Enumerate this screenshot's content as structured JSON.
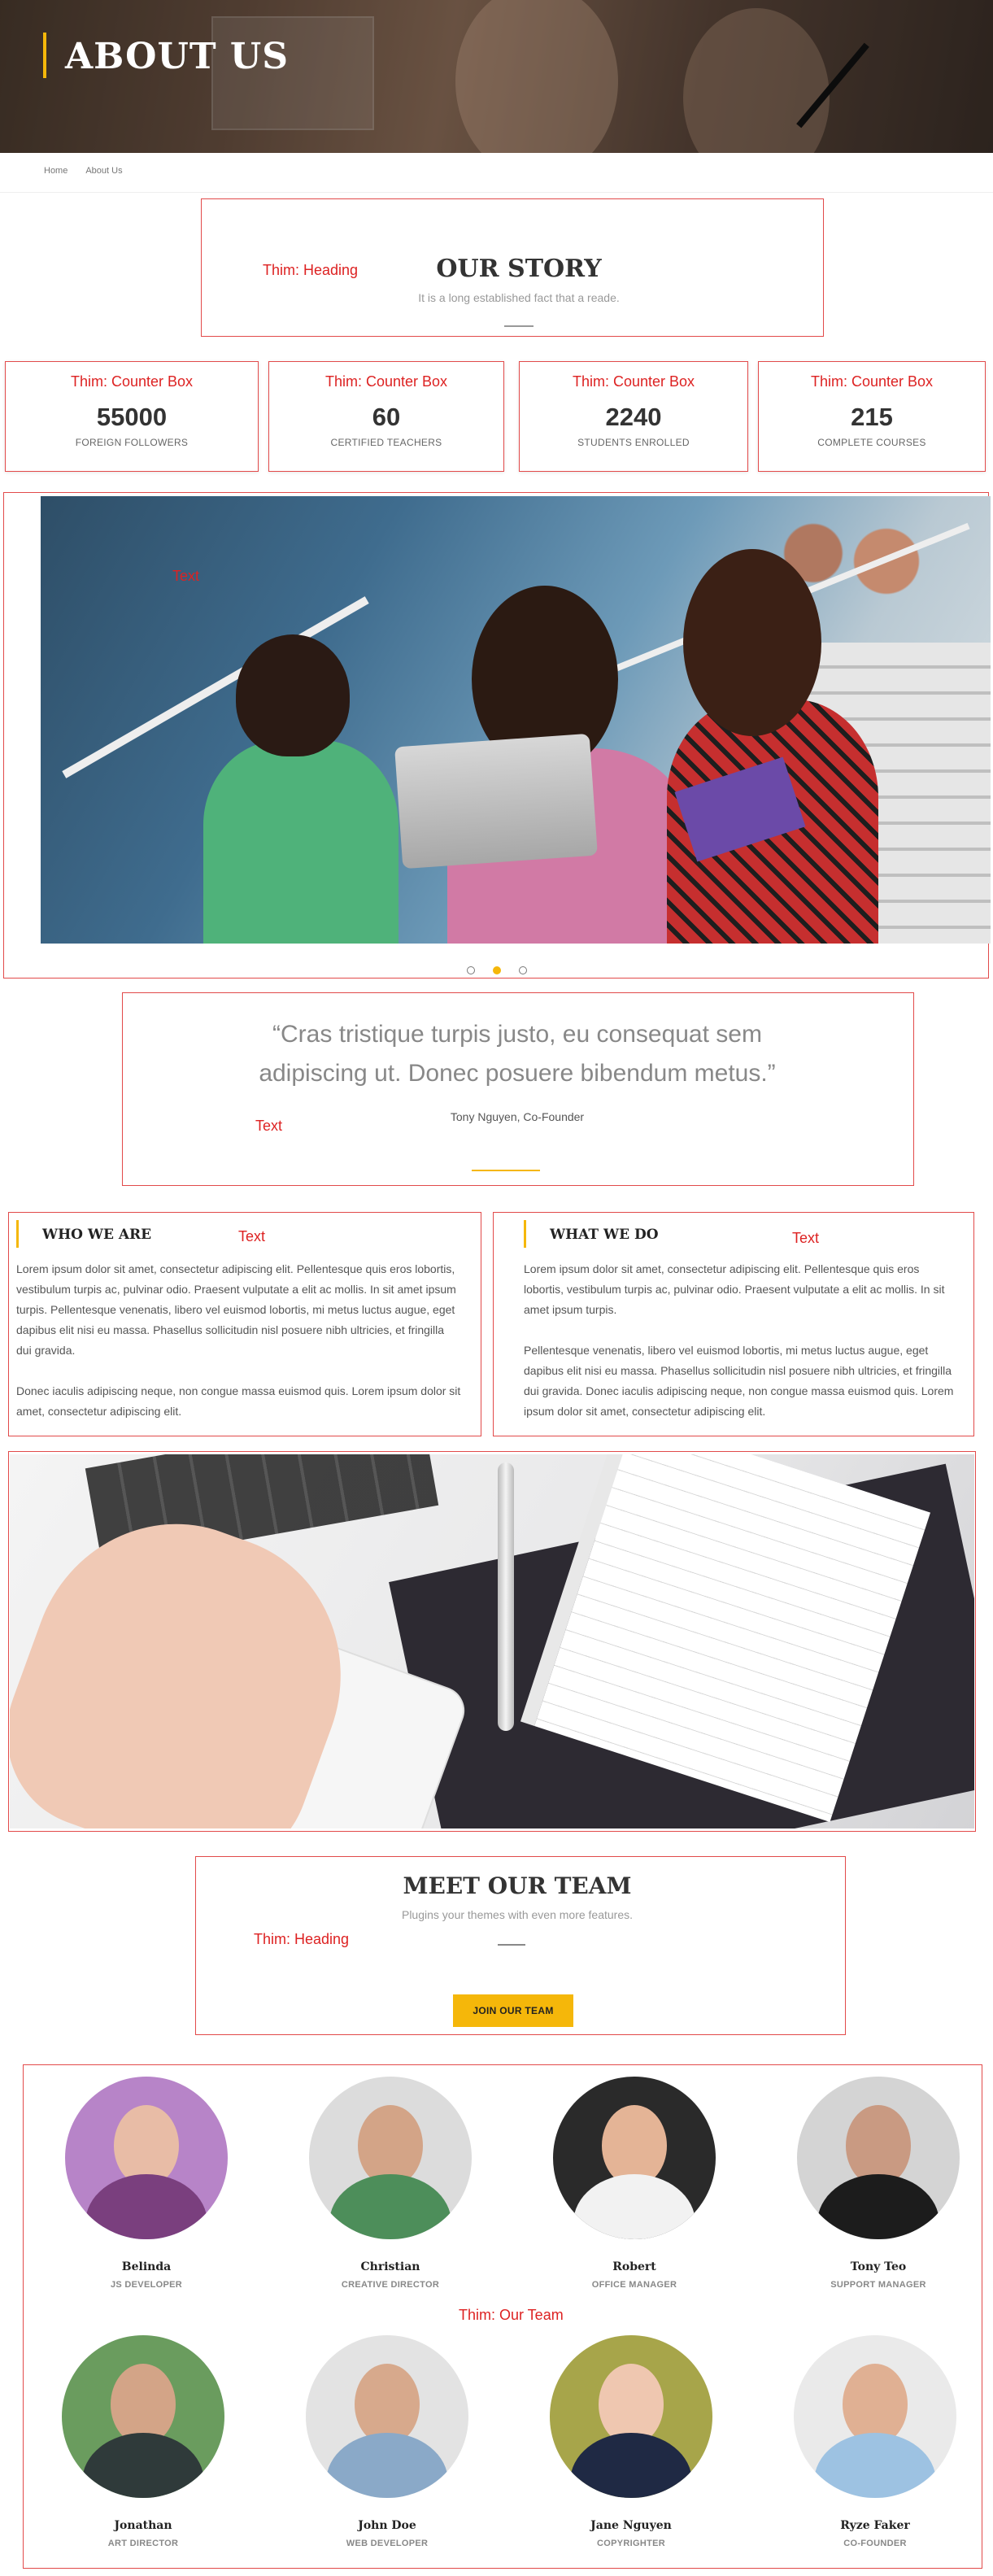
{
  "hero": {
    "title": "ABOUT US"
  },
  "breadcrumb": {
    "home": "Home",
    "current": "About Us"
  },
  "story": {
    "label": "Thim: Heading",
    "title": "OUR STORY",
    "subtitle": "It is a long established fact that a reade."
  },
  "counters": {
    "label": "Thim: Counter Box",
    "items": [
      {
        "value": "55000",
        "caption": "FOREIGN FOLLOWERS"
      },
      {
        "value": "60",
        "caption": "CERTIFIED TEACHERS"
      },
      {
        "value": "2240",
        "caption": "STUDENTS ENROLLED"
      },
      {
        "value": "215",
        "caption": "COMPLETE COURSES"
      }
    ]
  },
  "slider": {
    "label": "Text",
    "active_dot": 2,
    "dot_count": 3
  },
  "testimonial": {
    "label": "Text",
    "quote_line1": "“Cras tristique turpis justo, eu consequat sem",
    "quote_line2": "adipiscing ut. Donec posuere bibendum metus.”",
    "author": "Tony Nguyen, Co-Founder"
  },
  "who_we_are": {
    "title": "WHO WE ARE",
    "label": "Text",
    "p1": "Lorem ipsum dolor sit amet, consectetur adipiscing elit. Pellentesque quis eros lobortis, vestibulum turpis ac, pulvinar odio. Praesent vulputate a elit ac mollis. In sit amet ipsum turpis. Pellentesque venenatis, libero vel euismod lobortis, mi metus luctus augue, eget dapibus elit nisi eu massa. Phasellus sollicitudin nisl posuere nibh ultricies, et fringilla dui gravida.",
    "p2": "Donec iaculis adipiscing neque, non congue massa euismod quis. Lorem ipsum dolor sit amet, consectetur adipiscing elit."
  },
  "what_we_do": {
    "title": "WHAT WE DO",
    "label": "Text",
    "p1": "Lorem ipsum dolor sit amet, consectetur adipiscing elit. Pellentesque quis eros lobortis, vestibulum turpis ac, pulvinar odio. Praesent vulputate a elit ac mollis. In sit amet ipsum turpis.",
    "p2": "Pellentesque venenatis, libero vel euismod lobortis, mi metus luctus augue, eget dapibus elit nisi eu massa. Phasellus sollicitudin nisl posuere nibh ultricies, et fringilla dui gravida. Donec iaculis adipiscing neque, non congue massa euismod quis. Lorem ipsum dolor sit amet, consectetur adipiscing elit."
  },
  "team": {
    "label": "Thim: Heading",
    "title": "MEET OUR TEAM",
    "subtitle": "Plugins your themes with even more features.",
    "button": "JOIN OUR TEAM",
    "list_label": "Thim: Our Team",
    "members": [
      {
        "name": "Belinda",
        "role": "JS DEVELOPER"
      },
      {
        "name": "Christian",
        "role": "CREATIVE DIRECTOR"
      },
      {
        "name": "Robert",
        "role": "OFFICE MANAGER"
      },
      {
        "name": "Tony Teo",
        "role": "SUPPORT MANAGER"
      },
      {
        "name": "Jonathan",
        "role": "ART DIRECTOR"
      },
      {
        "name": "John Doe",
        "role": "WEB DEVELOPER"
      },
      {
        "name": "Jane Nguyen",
        "role": "COPYRIGHTER"
      },
      {
        "name": "Ryze Faker",
        "role": "CO-FOUNDER"
      }
    ]
  },
  "colors": {
    "accent": "#f5b70a",
    "annotation": "#e24a4a"
  }
}
